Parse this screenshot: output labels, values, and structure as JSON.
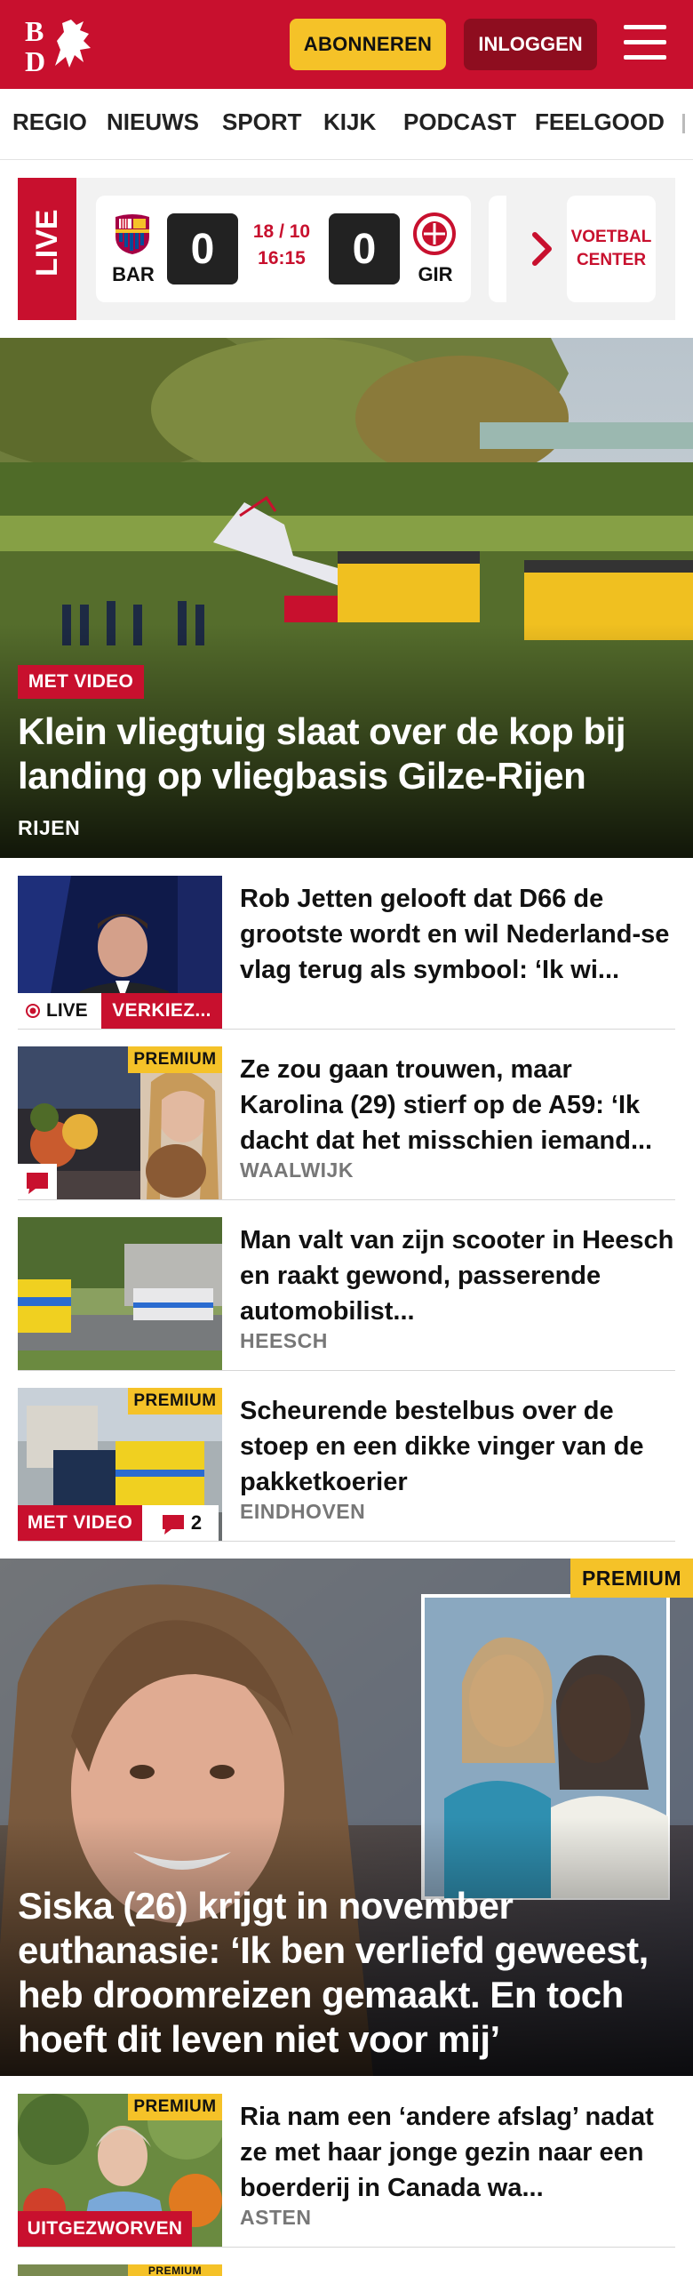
{
  "header": {
    "logo_text": "BD",
    "subscribe_label": "ABONNEREN",
    "login_label": "INLOGGEN",
    "brand_color": "#c8102e",
    "accent_color": "#f5c228",
    "menu_icon": "hamburger-icon"
  },
  "nav": {
    "items": [
      {
        "label": "REGIO"
      },
      {
        "label": "NIEUWS"
      },
      {
        "label": "SPORT"
      },
      {
        "label": "KIJK"
      },
      {
        "label": "PODCAST"
      },
      {
        "label": "FEELGOOD"
      }
    ]
  },
  "live": {
    "label": "LIVE",
    "match": {
      "home": "BAR",
      "away": "GIR",
      "home_score": "0",
      "away_score": "0",
      "date": "18 / 10",
      "time": "16:15"
    },
    "voetbal_center": "VOETBAL CENTER"
  },
  "hero": {
    "badge": "MET VIDEO",
    "title": "Klein vliegtuig slaat over de kop bij landing op vliegbasis Gilze-Rijen",
    "location": "RIJEN"
  },
  "articles": [
    {
      "title": "Rob Jetten gelooft dat D66 de grootste wordt en wil Nederland-se vlag terug als symbool: ‘Ik wi...",
      "live_label": "LIVE",
      "badge": "VERKIEZ..."
    },
    {
      "title": "Ze zou gaan trouwen, maar Karolina (29) stierf op de A59: ‘Ik dacht dat het misschien iemand...",
      "location": "WAALWIJK",
      "premium": "PREMIUM"
    },
    {
      "title": "Man valt van zijn scooter in Heesch en raakt gewond, passerende automobilist...",
      "location": "HEESCH"
    },
    {
      "title": "Scheurende bestelbus over de stoep en een dikke vinger van de pakketkoerier",
      "location": "EINDHOVEN",
      "premium": "PREMIUM",
      "badge": "MET VIDEO",
      "comments": "2"
    }
  ],
  "feature": {
    "premium": "PREMIUM",
    "title": "Siska (26) krijgt in november euthanasie: ‘Ik ben verliefd geweest, heb droomreizen gemaakt. En toch hoeft dit leven niet voor mij’"
  },
  "article_last": {
    "title": "Ria nam een ‘andere afslag’ nadat ze met haar jonge gezin naar een boerderij in Canada wa...",
    "location": "ASTEN",
    "premium": "PREMIUM",
    "badge": "UITGEZWORVEN"
  },
  "article_peek": {
    "premium": "PREMIUM"
  }
}
